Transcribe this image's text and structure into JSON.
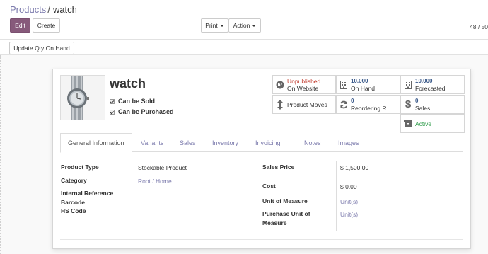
{
  "breadcrumb": {
    "parent": "Products",
    "separator": "/",
    "current": "watch"
  },
  "toolbar": {
    "edit": "Edit",
    "create": "Create",
    "print": "Print",
    "action": "Action",
    "pager": "48 / 50"
  },
  "statusbar": {
    "update_qty": "Update Qty On Hand"
  },
  "product": {
    "name": "watch",
    "can_be_sold": "Can be Sold",
    "can_be_purchased": "Can be Purchased"
  },
  "smart_buttons": {
    "website": {
      "status": "Unpublished",
      "label": "On Website"
    },
    "on_hand": {
      "value": "10.000",
      "label": "On Hand"
    },
    "forecasted": {
      "value": "10.000",
      "label": "Forecasted"
    },
    "moves": {
      "label": "Product Moves"
    },
    "reordering": {
      "value": "0",
      "label": "Reordering R..."
    },
    "sales": {
      "value": "0",
      "label": "Sales"
    },
    "active": {
      "label": "Active"
    }
  },
  "tabs": [
    "General Information",
    "Variants",
    "Sales",
    "Inventory",
    "Invoicing",
    "Notes",
    "Images"
  ],
  "fields": {
    "product_type": {
      "label": "Product Type",
      "value": "Stockable Product"
    },
    "category": {
      "label": "Category",
      "value": "Root / Home"
    },
    "internal_ref": {
      "label": "Internal Reference"
    },
    "barcode": {
      "label": "Barcode"
    },
    "hs_code": {
      "label": "HS Code"
    },
    "sales_price": {
      "label": "Sales Price",
      "value": "$ 1,500.00"
    },
    "cost": {
      "label": "Cost",
      "value": "$ 0.00"
    },
    "uom": {
      "label": "Unit of Measure",
      "value": "Unit(s)"
    },
    "purchase_uom": {
      "label_line1": "Purchase Unit of",
      "label_line2": "Measure",
      "value": "Unit(s)"
    }
  },
  "colors": {
    "accent": "#875a7b",
    "link": "#7c7bad",
    "unpublished": "#c0392b",
    "active": "#2e9c4a"
  }
}
